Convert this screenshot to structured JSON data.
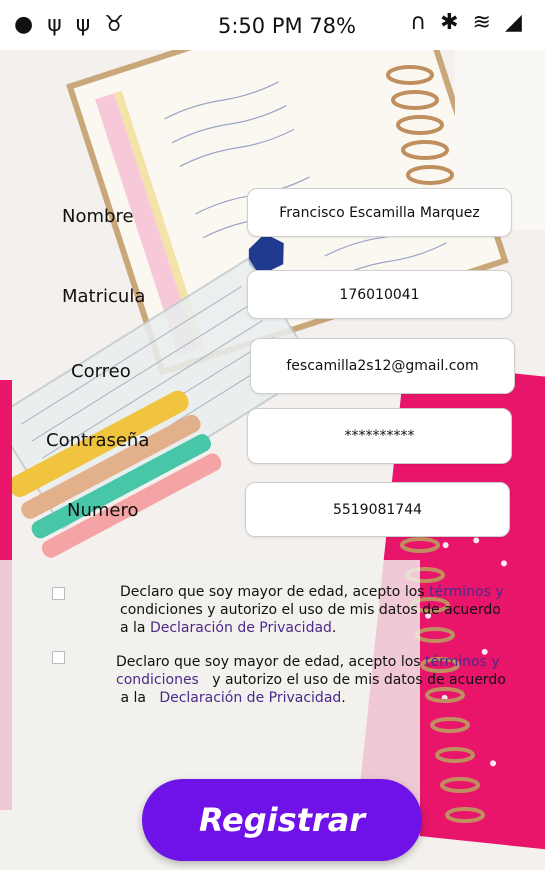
{
  "status_bar": {
    "time": "5:50 PM",
    "battery": "78%",
    "left_icons": [
      "app-icon",
      "usb-icon",
      "usb-icon",
      "android-icon"
    ],
    "right_icons": [
      "headphones-icon",
      "bluetooth-icon",
      "wifi-icon",
      "signal-icon"
    ]
  },
  "form": {
    "nombre": {
      "label": "Nombre",
      "value": "Francisco Escamilla Marquez"
    },
    "matricula": {
      "label": "Matricula",
      "value": "176010041"
    },
    "correo": {
      "label": "Correo",
      "value": "fescamilla2s12@gmail.com"
    },
    "contrasena": {
      "label": "Contraseña",
      "value": "**********"
    },
    "numero": {
      "label": "Numero",
      "value": "5519081744"
    }
  },
  "terms1": {
    "t1": "Declaro que soy mayor de edad, acepto los",
    "link1": "términos y",
    "t2": "condiciones y autorizo el uso de mis datos de acuerdo",
    "t3": "a la",
    "link2": "Declaración de Privacidad",
    "t4": "."
  },
  "terms2": {
    "t1": "Declaro que soy mayor de edad, acepto los",
    "link1a": "términos y",
    "link1b": "condiciones",
    "t2": "y autorizo el uso de mis datos de acuerdo",
    "t3": "a la",
    "link2": "Declaración de Privacidad",
    "t4": "."
  },
  "register_label": "Registrar",
  "colors": {
    "button": "#6f12e7",
    "link": "#4b2a8a",
    "notebook_pink": "#e8156b"
  }
}
